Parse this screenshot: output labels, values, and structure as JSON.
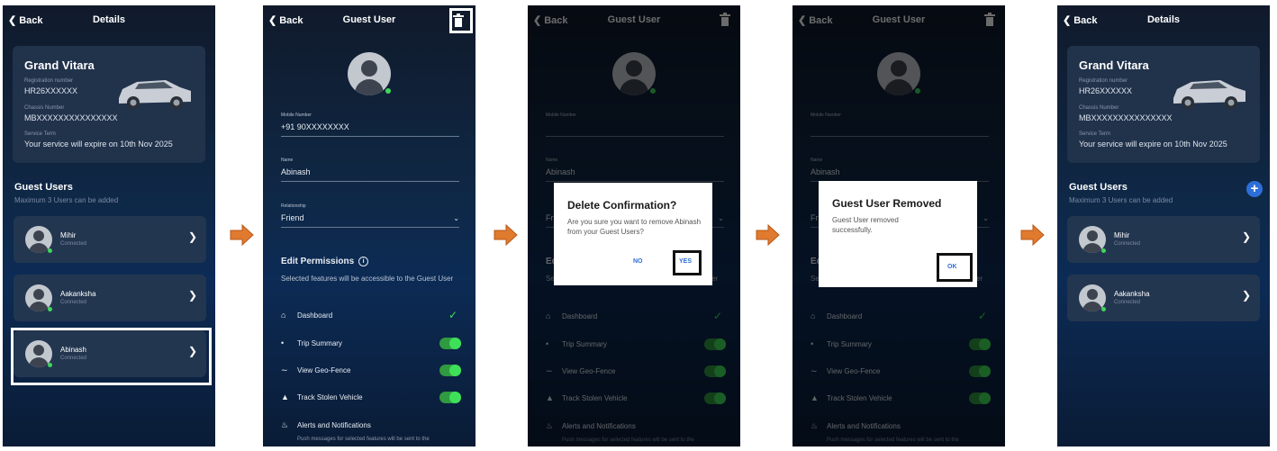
{
  "colors": {
    "accent": "#2d6ed8",
    "toggle": "#3ee05a",
    "highlight_box": "#111111",
    "arrow": "#e07a2e"
  },
  "common": {
    "back": "Back",
    "details_title": "Details",
    "guest_user_title": "Guest User"
  },
  "vehicle": {
    "name": "Grand Vitara",
    "reg_label": "Registration number",
    "reg_value": "HR26XXXXXX",
    "chassis_label": "Chassis Number",
    "chassis_value": "MBXXXXXXXXXXXXXXX",
    "service_label": "Service Term",
    "service_value": "Your service will expire on 10th Nov 2025"
  },
  "guests": {
    "title": "Guest Users",
    "subtitle": "Maximum 3 Users can be added",
    "status": "Connected",
    "users": [
      "Mihir",
      "Aakanksha",
      "Abinash"
    ],
    "users_after": [
      "Mihir",
      "Aakanksha"
    ]
  },
  "form": {
    "mobile_label": "Mobile Number",
    "mobile_value": "+91 90XXXXXXXX",
    "name_label": "Name",
    "name_value": "Abinash",
    "relationship_label": "Relationship",
    "relationship_value": "Friend",
    "perm_title": "Edit Permissions",
    "perm_sub": "Selected features will be accessible to the Guest User",
    "permissions": [
      "Dashboard",
      "Trip Summary",
      "View Geo-Fence",
      "Track Stolen Vehicle",
      "Alerts and Notifications"
    ],
    "alerts_sub": "Push messages for selected features will be sent to the"
  },
  "delete_dialog": {
    "title": "Delete Confirmation?",
    "message": "Are you sure you want to remove Abinash from your Guest Users?",
    "no": "NO",
    "yes": "YES"
  },
  "removed_dialog": {
    "title": "Guest User Removed",
    "message": "Guest User removed successfully.",
    "ok": "OK"
  }
}
